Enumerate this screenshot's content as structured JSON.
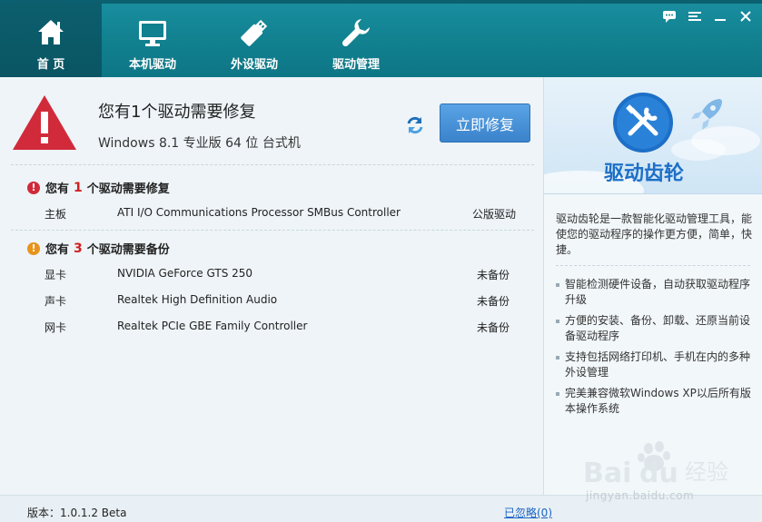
{
  "nav": {
    "items": [
      {
        "label": "首 页",
        "icon": "home-icon",
        "active": true
      },
      {
        "label": "本机驱动",
        "icon": "monitor-icon",
        "active": false
      },
      {
        "label": "外设驱动",
        "icon": "usb-drive-icon",
        "active": false
      },
      {
        "label": "驱动管理",
        "icon": "wrench-icon",
        "active": false
      }
    ]
  },
  "window_controls": [
    "feedback-icon",
    "menu-icon",
    "minimize-icon",
    "close-icon"
  ],
  "summary": {
    "headline": "您有1个驱动需要修复",
    "os": "Windows 8.1 专业版 64 位 台式机",
    "fix_button": "立即修复"
  },
  "repair": {
    "prefix": "您有",
    "count": "1",
    "suffix": "个驱动需要修复",
    "rows": [
      {
        "type": "主板",
        "name": "ATI I/O Communications Processor SMBus Controller",
        "status": "公版驱动"
      }
    ]
  },
  "backup": {
    "prefix": "您有",
    "count": "3",
    "suffix": "个驱动需要备份",
    "rows": [
      {
        "type": "显卡",
        "name": "NVIDIA GeForce GTS 250",
        "status": "未备份"
      },
      {
        "type": "声卡",
        "name": "Realtek High Definition Audio",
        "status": "未备份"
      },
      {
        "type": "网卡",
        "name": "Realtek PCIe GBE Family Controller",
        "status": "未备份"
      }
    ]
  },
  "side": {
    "brand": "驱动齿轮",
    "description": "驱动齿轮是一款智能化驱动管理工具，能使您的驱动程序的操作更方便，简单，快捷。",
    "features": [
      "智能检测硬件设备，自动获取驱动程序升级",
      "方便的安装、备份、卸载、还原当前设备驱动程序",
      "支持包括网络打印机、手机在内的多种外设管理",
      "完美兼容微软Windows XP以后所有版本操作系统"
    ]
  },
  "footer": {
    "version": "版本：1.0.1.2 Beta",
    "ignored": "已忽略(0)"
  },
  "watermark": {
    "logo": "Bai du 经验",
    "url": "jingyan.baidu.com"
  },
  "colors": {
    "topbar": "#11808f",
    "active_tab": "#0c5f6e",
    "alert_red": "#d12a3a",
    "warn_orange": "#e8931b",
    "button_blue": "#3a83cc",
    "brand_blue": "#1d6fc7"
  }
}
